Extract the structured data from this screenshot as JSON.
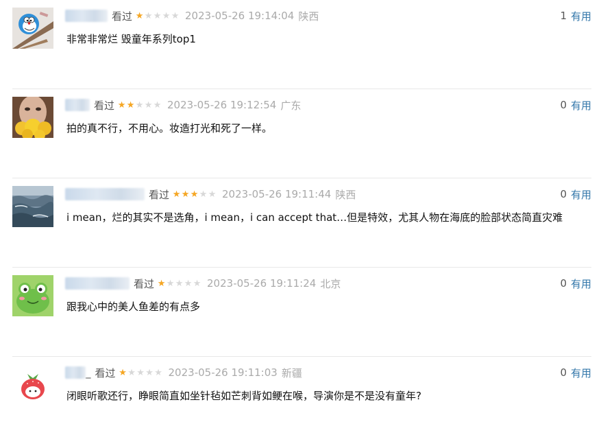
{
  "comments": [
    {
      "status": "看过",
      "rating": 1,
      "time": "2023-05-26 19:14:04",
      "location": "陕西",
      "votes": "1",
      "useful_label": "有用",
      "content": "非常非常烂 毁童年系列top1",
      "avatar_icon": "doraemon-avatar"
    },
    {
      "status": "看过",
      "rating": 2,
      "time": "2023-05-26 19:12:54",
      "location": "广东",
      "votes": "0",
      "useful_label": "有用",
      "content": "拍的真不行，不用心。妆造打光和死了一样。",
      "avatar_icon": "girl-with-flowers-avatar"
    },
    {
      "status": "看过",
      "rating": 3,
      "time": "2023-05-26 19:11:44",
      "location": "陕西",
      "votes": "0",
      "useful_label": "有用",
      "content": "i mean，烂的其实不是选角，i mean，i can accept that…但是特效，尤其人物在海底的脸部状态简直灾难",
      "avatar_icon": "ocean-waves-avatar"
    },
    {
      "status": "看过",
      "rating": 1,
      "time": "2023-05-26 19:11:24",
      "location": "北京",
      "votes": "0",
      "useful_label": "有用",
      "content": "跟我心中的美人鱼差的有点多",
      "avatar_icon": "green-frog-avatar"
    },
    {
      "status": "看过",
      "rating": 1,
      "time": "2023-05-26 19:11:03",
      "location": "新疆",
      "votes": "0",
      "useful_label": "有用",
      "content": "闭眼听歌还行，睁眼简直如坐针毡如芒刺背如鲠在喉，导演你是不是没有童年?",
      "avatar_icon": "strawberry-avatar",
      "username_suffix": "_"
    }
  ]
}
